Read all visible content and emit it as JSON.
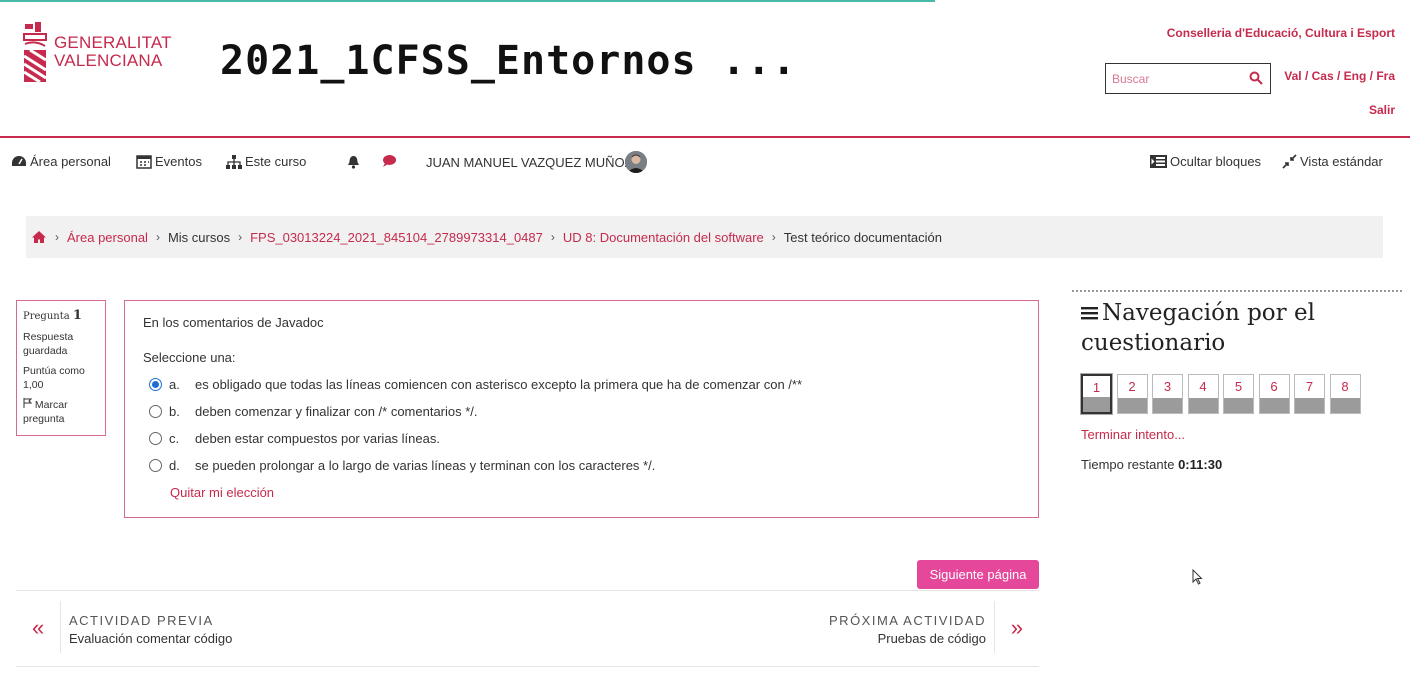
{
  "header": {
    "logo_lines": [
      "GENERALITAT",
      "VALENCIANA"
    ],
    "course_title": "2021_1CFSS_Entornos ...",
    "conselleria": "Conselleria d'Educació, Cultura i Esport",
    "search_placeholder": "Buscar",
    "languages": "Val / Cas / Eng / Fra",
    "logout": "Salir"
  },
  "nav": {
    "dashboard": "Área personal",
    "events": "Eventos",
    "this_course": "Este curso",
    "user_name": "JUAN MANUEL VAZQUEZ MUÑOZ",
    "hide_blocks": "Ocultar bloques",
    "standard_view": "Vista estándar"
  },
  "breadcrumb": {
    "items": [
      "Área personal",
      "Mis cursos",
      "FPS_03013224_2021_845104_2789973314_0487",
      "UD 8: Documentación del software",
      "Test teórico documentación"
    ]
  },
  "question_info": {
    "label": "Pregunta",
    "number": "1",
    "state": "Respuesta guardada",
    "marks": "Puntúa como 1,00",
    "flag": "Marcar pregunta"
  },
  "question": {
    "text": "En los comentarios de Javadoc",
    "prompt": "Seleccione una:",
    "options": [
      {
        "letter": "a.",
        "text": "es obligado que todas las líneas comiencen con asterisco excepto la primera que ha de comenzar con /**",
        "selected": true
      },
      {
        "letter": "b.",
        "text": "deben comenzar y finalizar con /* comentarios */.",
        "selected": false
      },
      {
        "letter": "c.",
        "text": "deben estar compuestos por varias líneas.",
        "selected": false
      },
      {
        "letter": "d.",
        "text": "se pueden prolongar a lo largo de varias líneas y terminan con los caracteres */.",
        "selected": false
      }
    ],
    "clear_choice": "Quitar mi elección"
  },
  "next_page": "Siguiente página",
  "activity_nav": {
    "prev_label": "ACTIVIDAD PREVIA",
    "prev_name": "Evaluación comentar código",
    "next_label": "PRÓXIMA ACTIVIDAD",
    "next_name": "Pruebas de código"
  },
  "quiz_nav": {
    "title": "Navegación por el cuestionario",
    "questions": [
      "1",
      "2",
      "3",
      "4",
      "5",
      "6",
      "7",
      "8"
    ],
    "finish": "Terminar intento...",
    "time_label": "Tiempo restante",
    "time_value": "0:11:30"
  },
  "colors": {
    "accent": "#c62a4c",
    "button": "#e5479a",
    "radio_selected": "#1d6fd6"
  }
}
